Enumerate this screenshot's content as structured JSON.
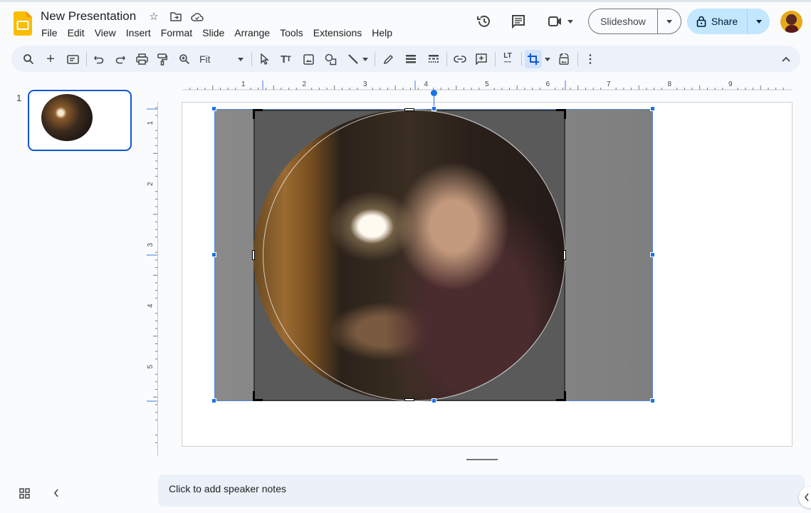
{
  "app": {
    "title": "New Presentation",
    "title_icons": [
      "star-icon",
      "move-to-folder-icon",
      "cloud-saved-icon"
    ]
  },
  "menu": [
    "File",
    "Edit",
    "View",
    "Insert",
    "Format",
    "Slide",
    "Arrange",
    "Tools",
    "Extensions",
    "Help"
  ],
  "header_actions": {
    "history_icon": "version-history-icon",
    "comments_icon": "comments-icon",
    "meet_icon": "video-call-icon",
    "slideshow_label": "Slideshow",
    "share_label": "Share"
  },
  "toolbar": {
    "zoom_value": "Fit",
    "buttons": [
      "search-menus",
      "new-slide",
      "layout",
      "undo",
      "redo",
      "print",
      "paint-format",
      "zoom",
      "select",
      "text-box",
      "image",
      "shape",
      "line",
      "border-color",
      "border-weight",
      "border-dash",
      "insert-link",
      "add-comment",
      "alt-text",
      "crop-image",
      "reset-image",
      "more"
    ],
    "active_button": "crop-image"
  },
  "filmstrip": {
    "slides": [
      {
        "number": "1",
        "selected": true
      }
    ]
  },
  "rulers": {
    "horizontal_labels": [
      "1",
      "2",
      "3",
      "4",
      "5",
      "6",
      "7",
      "8",
      "9"
    ],
    "vertical_labels": [
      "1",
      "2",
      "3",
      "4",
      "5"
    ]
  },
  "canvas": {
    "selected_object": "image",
    "mode": "crop",
    "mask_shape": "ellipse"
  },
  "notes": {
    "placeholder": "Click to add speaker notes"
  }
}
